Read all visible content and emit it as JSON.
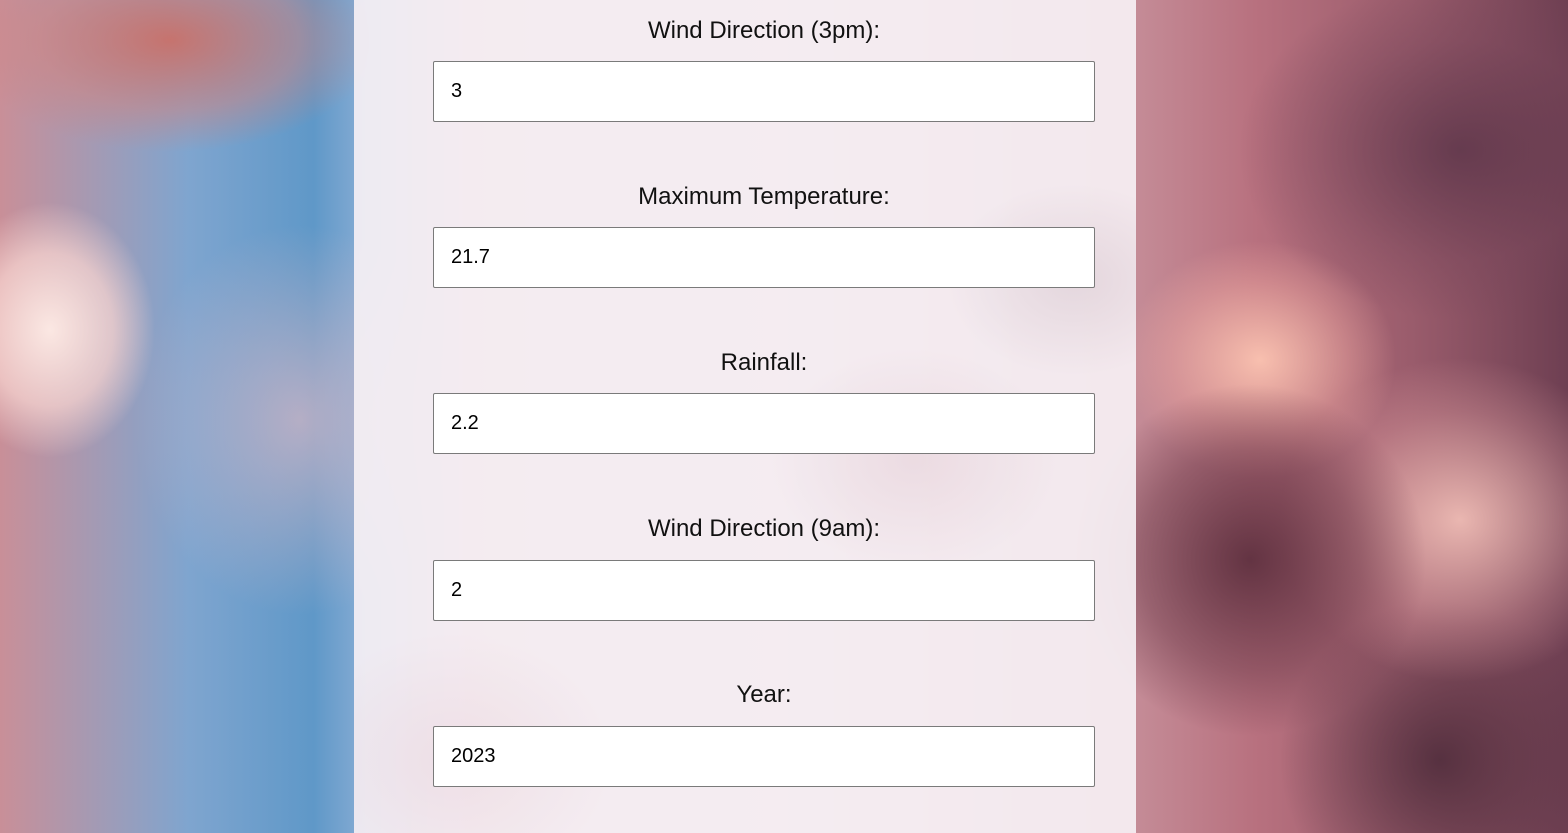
{
  "form": {
    "fields": [
      {
        "label": "Wind Direction (3pm):",
        "value": "3"
      },
      {
        "label": "Maximum Temperature:",
        "value": "21.7"
      },
      {
        "label": "Rainfall:",
        "value": "2.2"
      },
      {
        "label": "Wind Direction (9am):",
        "value": "2"
      },
      {
        "label": "Year:",
        "value": "2023"
      }
    ]
  },
  "colors": {
    "panel_background": "#f6f0f4",
    "label_text": "#111111",
    "input_border": "#7a7a7a",
    "input_background": "#ffffff"
  }
}
